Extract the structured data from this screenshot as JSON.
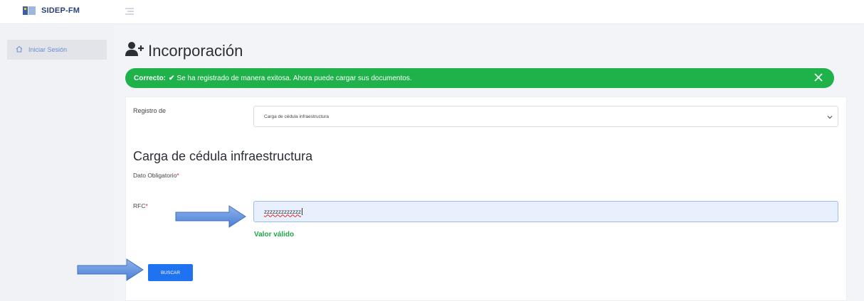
{
  "app": {
    "brand": "SIDEP-FM"
  },
  "sidebar": {
    "items": [
      {
        "label": "Iniciar Sesión"
      }
    ]
  },
  "page": {
    "title": "Incorporación"
  },
  "alert": {
    "strong": "Correcto:",
    "message": "Se ha registrado de manera exitosa. Ahora puede cargar sus documentos.",
    "color": "#1fb24b"
  },
  "form": {
    "registro_label": "Registro de",
    "registro_selected": "Carga de cédula infraestructura",
    "section_title": "Carga de cédula infraestructura",
    "required_note": "Dato Obligatorio",
    "rfc_label": "RFC",
    "rfc_value": "zzzzzzzzzzzzz",
    "valid_message": "Valor válido",
    "search_button": "BUSCAR"
  },
  "colors": {
    "accent": "#1f73f0",
    "success": "#1fa64a",
    "required": "#e02020"
  },
  "icons": [
    "logo-icon",
    "menu-toggle-icon",
    "home-icon",
    "user-plus-icon",
    "check-icon",
    "close-icon",
    "chevron-down-icon",
    "arrow-right-icon"
  ]
}
